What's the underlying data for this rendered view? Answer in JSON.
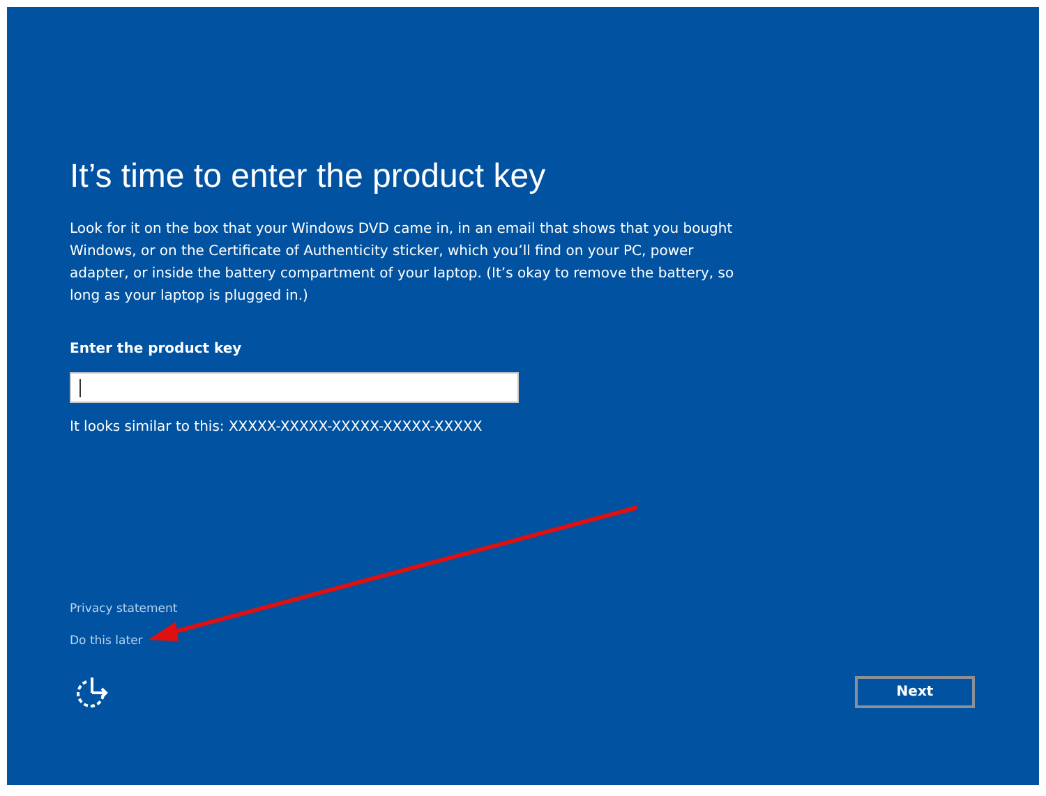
{
  "heading": "It’s time to enter the product key",
  "description": "Look for it on the box that your Windows DVD came in, in an email that shows that you bought Windows, or on the Certificate of Authenticity sticker, which you’ll find on your PC, power adapter, or inside the battery compartment of your laptop. (It’s okay to remove the battery, so long as your laptop is plugged in.)",
  "product_key": {
    "label": "Enter the product key",
    "hint": "It looks similar to this: XXXXX-XXXXX-XXXXX-XXXXX-XXXXX"
  },
  "links": [
    "Privacy statement",
    "Do this later"
  ],
  "buttons": [
    "Next"
  ]
}
